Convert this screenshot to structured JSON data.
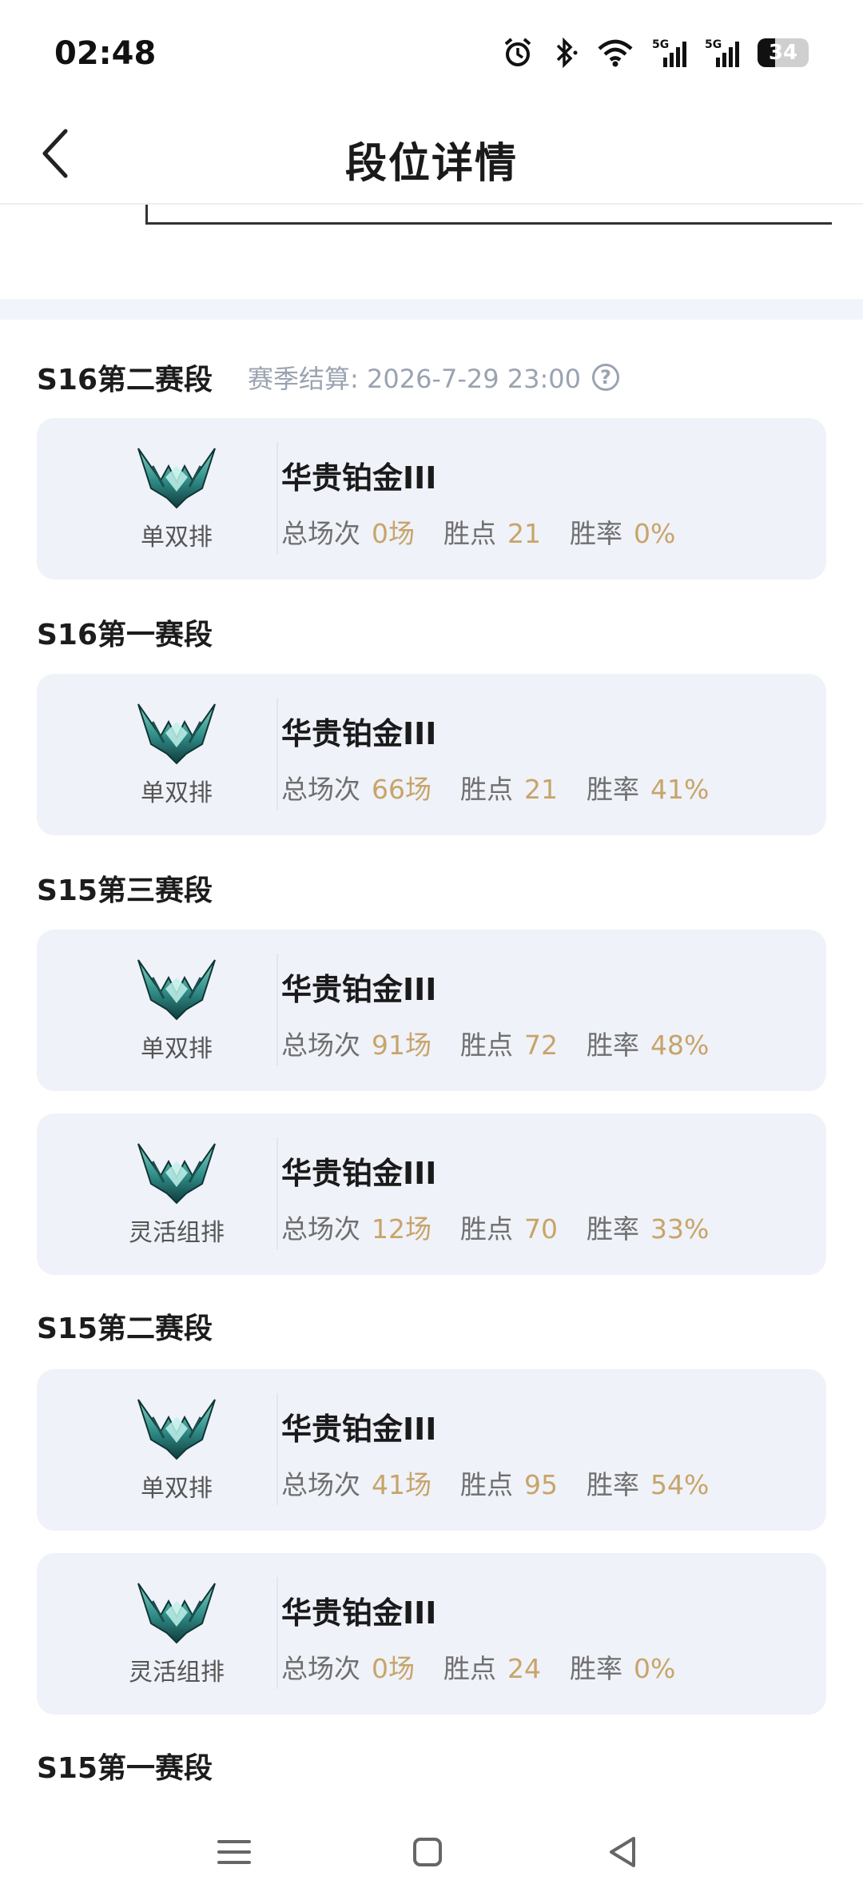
{
  "status_bar": {
    "time": "02:48",
    "battery": "34",
    "battery_level": 0.34
  },
  "header": {
    "title": "段位详情"
  },
  "season_end": "赛季结算: 2026-7-29 23:00",
  "stat_labels": {
    "games": "总场次",
    "points": "胜点",
    "winrate": "胜率"
  },
  "sections": [
    {
      "title": "S16第二赛段",
      "cards": [
        {
          "queue": "单双排",
          "rank": "华贵铂金III",
          "games": "0场",
          "points": "21",
          "winrate": "0%"
        }
      ]
    },
    {
      "title": "S16第一赛段",
      "cards": [
        {
          "queue": "单双排",
          "rank": "华贵铂金III",
          "games": "66场",
          "points": "21",
          "winrate": "41%"
        }
      ]
    },
    {
      "title": "S15第三赛段",
      "cards": [
        {
          "queue": "单双排",
          "rank": "华贵铂金III",
          "games": "91场",
          "points": "72",
          "winrate": "48%"
        },
        {
          "queue": "灵活组排",
          "rank": "华贵铂金III",
          "games": "12场",
          "points": "70",
          "winrate": "33%"
        }
      ]
    },
    {
      "title": "S15第二赛段",
      "cards": [
        {
          "queue": "单双排",
          "rank": "华贵铂金III",
          "games": "41场",
          "points": "95",
          "winrate": "54%"
        },
        {
          "queue": "灵活组排",
          "rank": "华贵铂金III",
          "games": "0场",
          "points": "24",
          "winrate": "0%"
        }
      ]
    },
    {
      "title": "S15第一赛段",
      "cards": []
    }
  ],
  "colors": {
    "accent_value": "#c8a46a",
    "card_bg": "#eff2f8",
    "emblem": "#2f8a86"
  },
  "icons": [
    "alarm-icon",
    "bluetooth-icon",
    "wifi-icon",
    "signal-5g-icon",
    "battery-icon",
    "back-arrow-icon",
    "help-icon",
    "platinum-emblem-icon",
    "menu-icon",
    "home-icon",
    "back-nav-icon"
  ]
}
